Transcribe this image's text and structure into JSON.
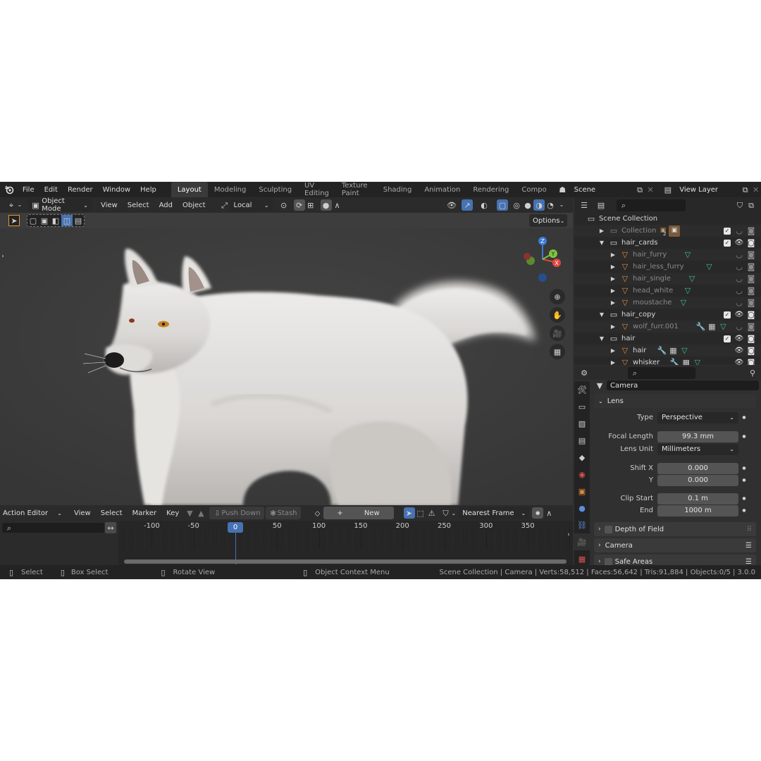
{
  "menu": [
    "File",
    "Edit",
    "Render",
    "Window",
    "Help"
  ],
  "workspaces": [
    "Layout",
    "Modeling",
    "Sculpting",
    "UV Editing",
    "Texture Paint",
    "Shading",
    "Animation",
    "Rendering",
    "Compo"
  ],
  "active_workspace": "Layout",
  "scene_name": "Scene",
  "view_layer": "View Layer",
  "viewport": {
    "mode": "Object Mode",
    "menus": [
      "View",
      "Select",
      "Add",
      "Object"
    ],
    "transform_orientation": "Local",
    "options_label": "Options"
  },
  "outliner": {
    "rows": [
      {
        "name": "Scene Collection",
        "indent": 0,
        "kind": "scene",
        "dim": false
      },
      {
        "name": "Collection",
        "indent": 1,
        "kind": "collection",
        "dim": true,
        "badge": "2"
      },
      {
        "name": "hair_cards",
        "indent": 1,
        "kind": "collection",
        "dim": false
      },
      {
        "name": "hair_furry",
        "indent": 2,
        "kind": "object",
        "dim": true
      },
      {
        "name": "hair_less_furry",
        "indent": 2,
        "kind": "object",
        "dim": true
      },
      {
        "name": "hair_single",
        "indent": 2,
        "kind": "object",
        "dim": true
      },
      {
        "name": "head_white",
        "indent": 2,
        "kind": "object",
        "dim": true
      },
      {
        "name": "moustache",
        "indent": 2,
        "kind": "object",
        "dim": true
      },
      {
        "name": "hair_copy",
        "indent": 1,
        "kind": "collection",
        "dim": false
      },
      {
        "name": "wolf_furr.001",
        "indent": 2,
        "kind": "object",
        "dim": true
      },
      {
        "name": "hair",
        "indent": 1,
        "kind": "collection",
        "dim": false
      },
      {
        "name": "hair",
        "indent": 2,
        "kind": "object",
        "dim": false
      },
      {
        "name": "whisker",
        "indent": 2,
        "kind": "object",
        "dim": false
      }
    ]
  },
  "properties": {
    "context": "Camera",
    "lens_panel": "Lens",
    "type_label": "Type",
    "type_value": "Perspective",
    "focal_label": "Focal Length",
    "focal_value": "99.3 mm",
    "lens_unit_label": "Lens Unit",
    "lens_unit_value": "Millimeters",
    "shift_x_label": "Shift X",
    "shift_x_value": "0.000",
    "y_label": "Y",
    "y_value": "0.000",
    "clip_start_label": "Clip Start",
    "clip_start_value": "0.1 m",
    "end_label": "End",
    "end_value": "1000 m",
    "dof_panel": "Depth of Field",
    "camera_panel": "Camera",
    "safe_panel": "Safe Areas"
  },
  "timeline": {
    "editor": "Action Editor",
    "menus": [
      "View",
      "Select",
      "Marker",
      "Key"
    ],
    "push_down": "Push Down",
    "stash": "Stash",
    "new_label": "New",
    "snap": "Nearest Frame",
    "ticks": [
      "-100",
      "-50",
      "0",
      "50",
      "100",
      "150",
      "200",
      "250",
      "300",
      "350"
    ],
    "current_frame": "0"
  },
  "status": {
    "select": "Select",
    "box_select": "Box Select",
    "rotate": "Rotate View",
    "context_menu": "Object Context Menu",
    "info": "Scene Collection | Camera | Verts:58,512 | Faces:56,642 | Tris:91,884 | Objects:0/5 | 3.0.0"
  },
  "colors": {
    "accent": "#4772b3",
    "object_orange": "#e08a3c",
    "hair_green": "#3ec48b",
    "axis_x": "#e2463f",
    "axis_y": "#7ec43f",
    "axis_z": "#3a7bd5"
  }
}
